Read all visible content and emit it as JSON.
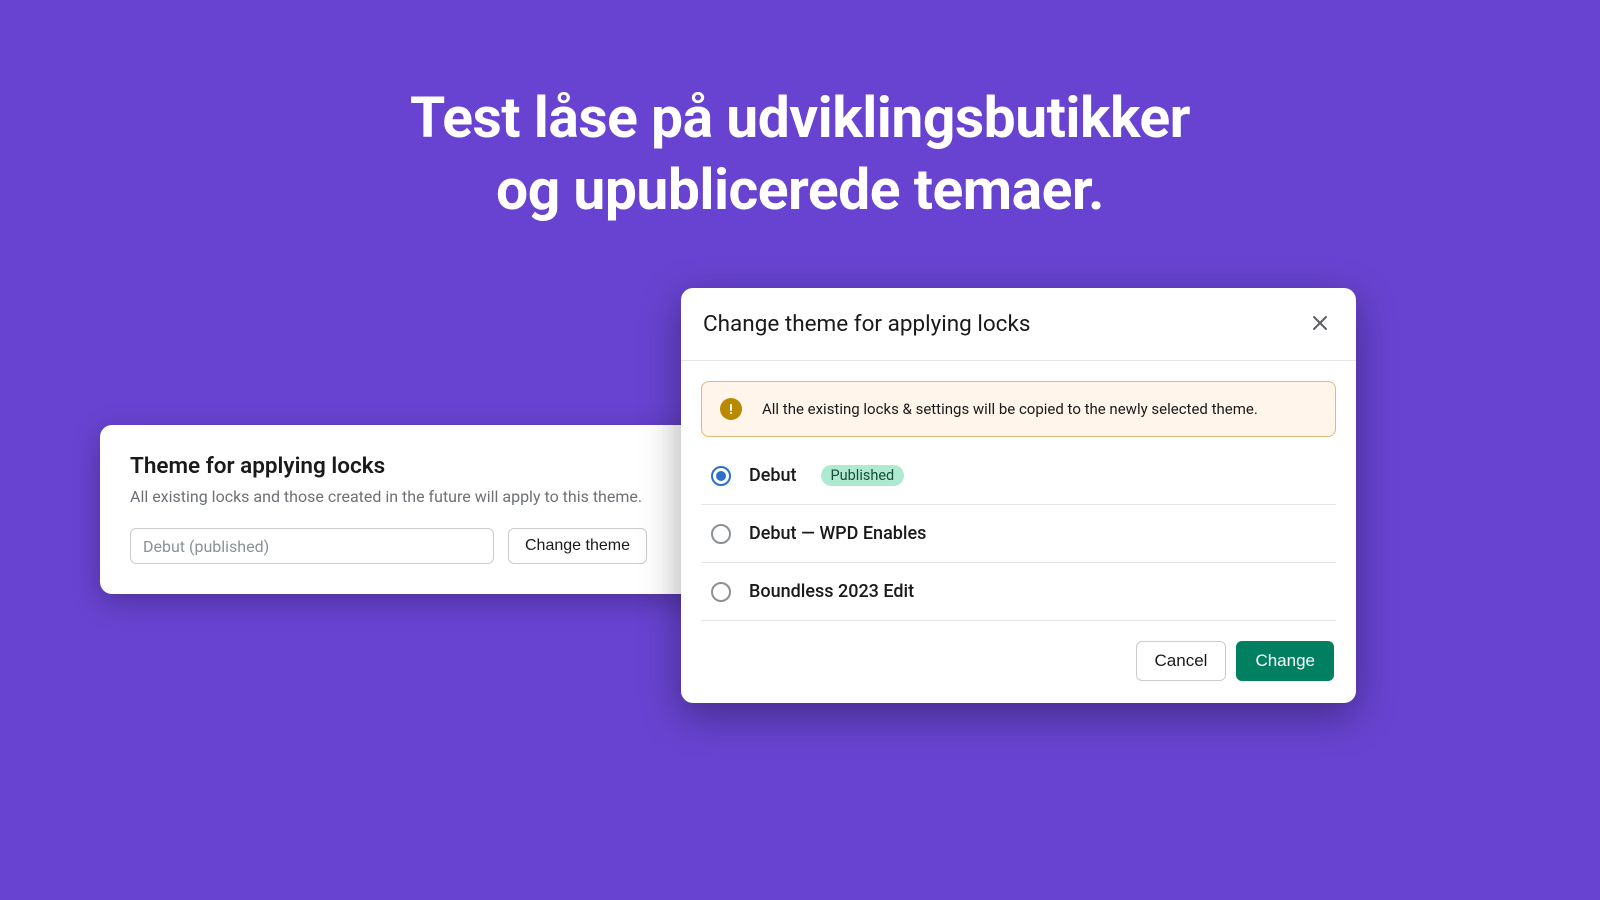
{
  "hero": {
    "line1": "Test låse på udviklingsbutikker",
    "line2": "og upublicerede temaer."
  },
  "small_card": {
    "title": "Theme for applying locks",
    "subtitle": "All existing locks and those created in the future will apply to this theme.",
    "input_value": "Debut (published)",
    "change_button": "Change theme"
  },
  "modal": {
    "title": "Change theme for applying locks",
    "banner": "All the existing locks & settings will be copied to the newly selected theme.",
    "options": [
      {
        "label": "Debut",
        "badge": "Published",
        "selected": true
      },
      {
        "label": "Debut — WPD Enables",
        "badge": null,
        "selected": false
      },
      {
        "label": "Boundless 2023 Edit",
        "badge": null,
        "selected": false
      }
    ],
    "footer": {
      "cancel": "Cancel",
      "confirm": "Change"
    }
  },
  "colors": {
    "background": "#6843d1",
    "primary_button": "#008060",
    "badge_bg": "#aee9d1",
    "banner_bg": "#fff5ea",
    "banner_border": "#e1b878",
    "radio_checked": "#2c6ecb"
  }
}
